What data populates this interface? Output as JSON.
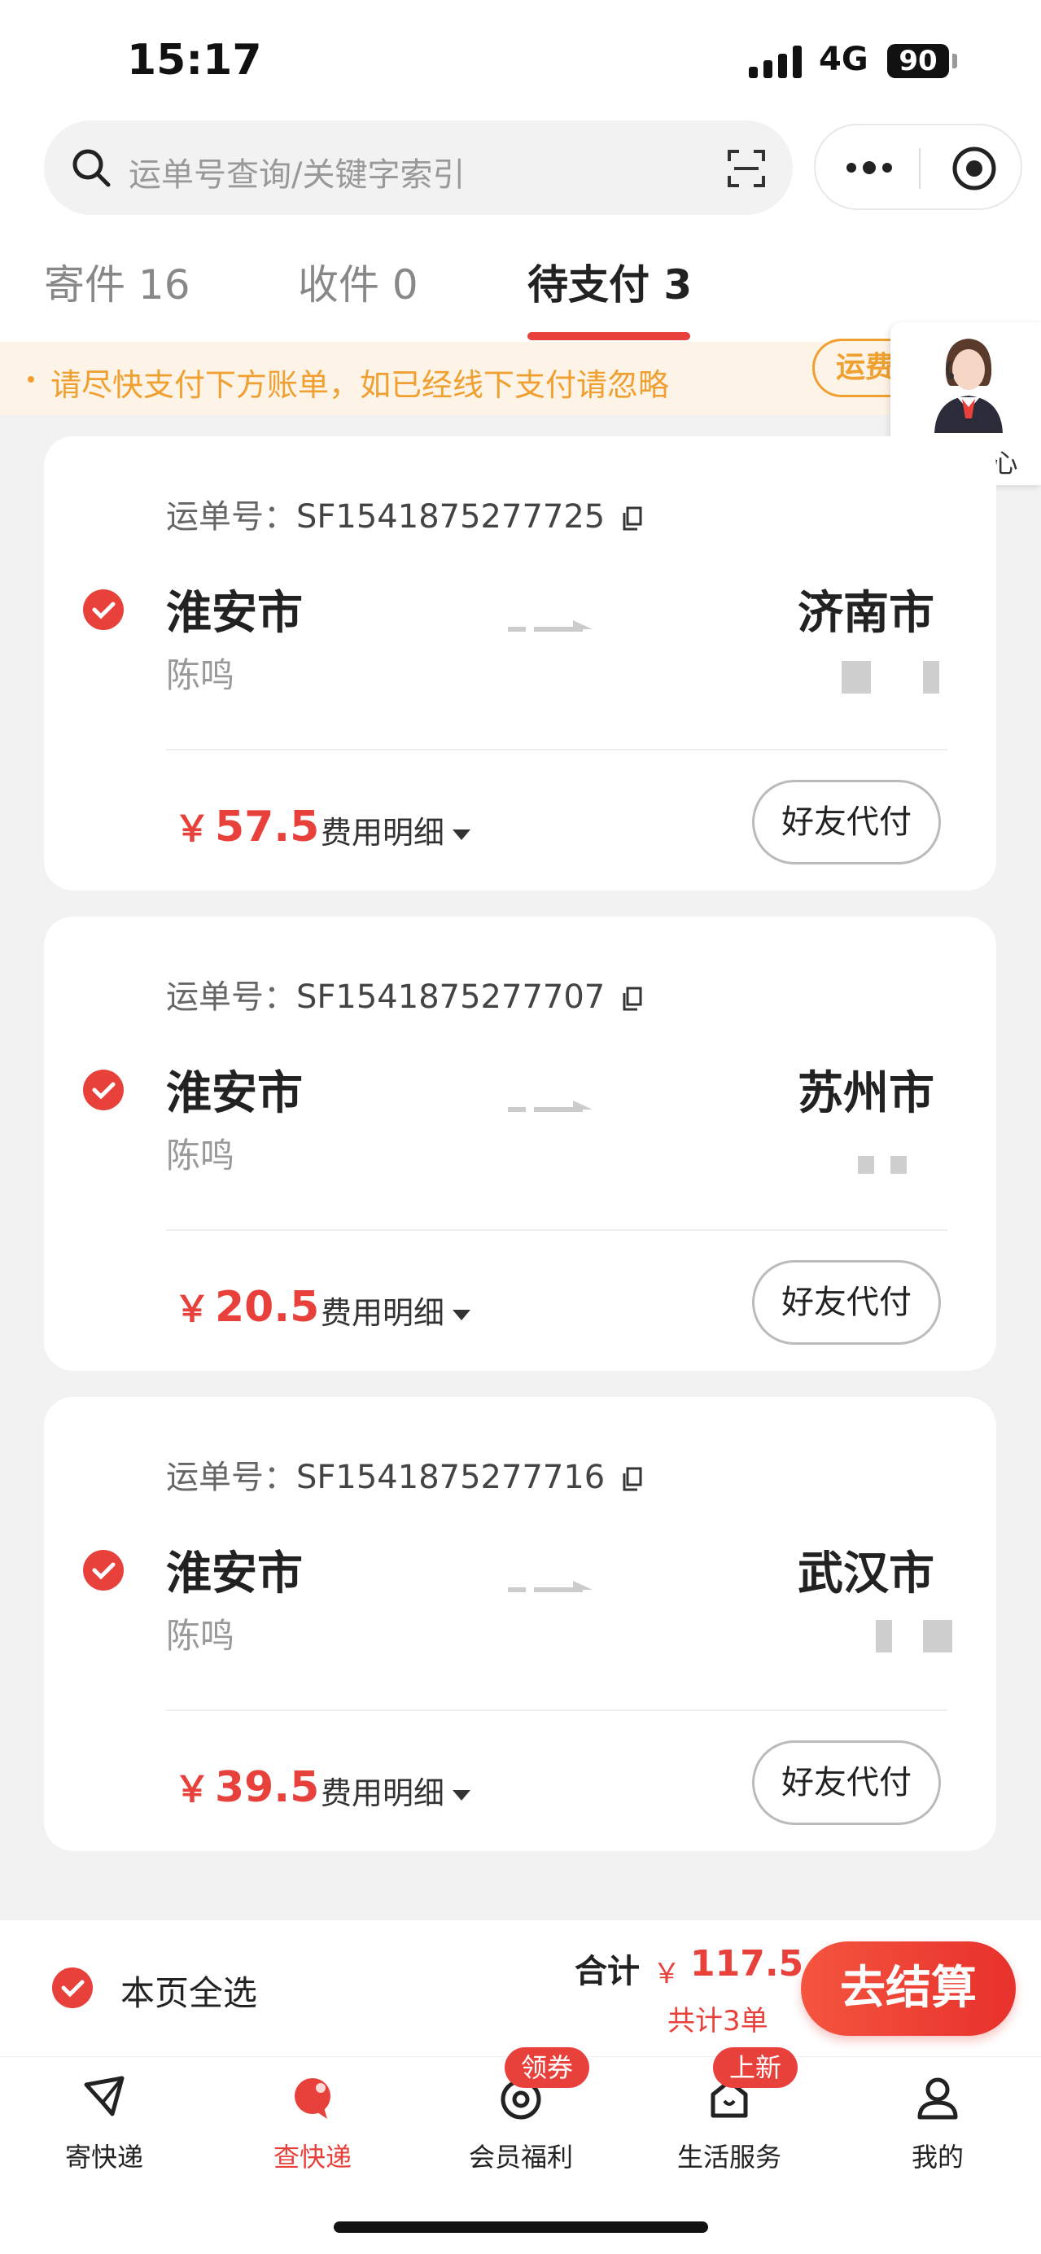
{
  "status_bar": {
    "time": "15:17",
    "network": "4G",
    "battery": "90"
  },
  "search": {
    "placeholder": "运单号查询/关键字索引"
  },
  "tabs": [
    {
      "label": "寄件 16",
      "active": false
    },
    {
      "label": "收件 0",
      "active": false
    },
    {
      "label": "待支付 3",
      "active": true
    }
  ],
  "notice": {
    "text": "请尽快支付下方账单，如已经线下支付请忽略",
    "button": "运费反馈"
  },
  "customer_service": {
    "label": "客服中心"
  },
  "orders": [
    {
      "waybill_label": "运单号：",
      "waybill": "SF1541875277725",
      "from_city": "淮安市",
      "sender": "陈鸣",
      "to_city": "济南市",
      "price": "57.5",
      "currency": "￥",
      "fee_label": "费用明细",
      "friend_pay": "好友代付",
      "checked": true
    },
    {
      "waybill_label": "运单号：",
      "waybill": "SF1541875277707",
      "from_city": "淮安市",
      "sender": "陈鸣",
      "to_city": "苏州市",
      "price": "20.5",
      "currency": "￥",
      "fee_label": "费用明细",
      "friend_pay": "好友代付",
      "checked": true
    },
    {
      "waybill_label": "运单号：",
      "waybill": "SF1541875277716",
      "from_city": "淮安市",
      "sender": "陈鸣",
      "to_city": "武汉市",
      "price": "39.5",
      "currency": "￥",
      "fee_label": "费用明细",
      "friend_pay": "好友代付",
      "checked": true
    }
  ],
  "checkout": {
    "select_all": "本页全选",
    "total_label": "合计",
    "currency": "￥",
    "total": "117.5",
    "count": "共计3单",
    "button": "去结算"
  },
  "tabbar": [
    {
      "label": "寄快递",
      "icon": "send-icon"
    },
    {
      "label": "查快递",
      "icon": "query-icon",
      "active": true
    },
    {
      "label": "会员福利",
      "icon": "member-icon",
      "badge": "领券"
    },
    {
      "label": "生活服务",
      "icon": "life-service-icon",
      "badge": "上新"
    },
    {
      "label": "我的",
      "icon": "profile-icon"
    }
  ],
  "colors": {
    "accent": "#e8413c",
    "notice": "#f0a030"
  }
}
